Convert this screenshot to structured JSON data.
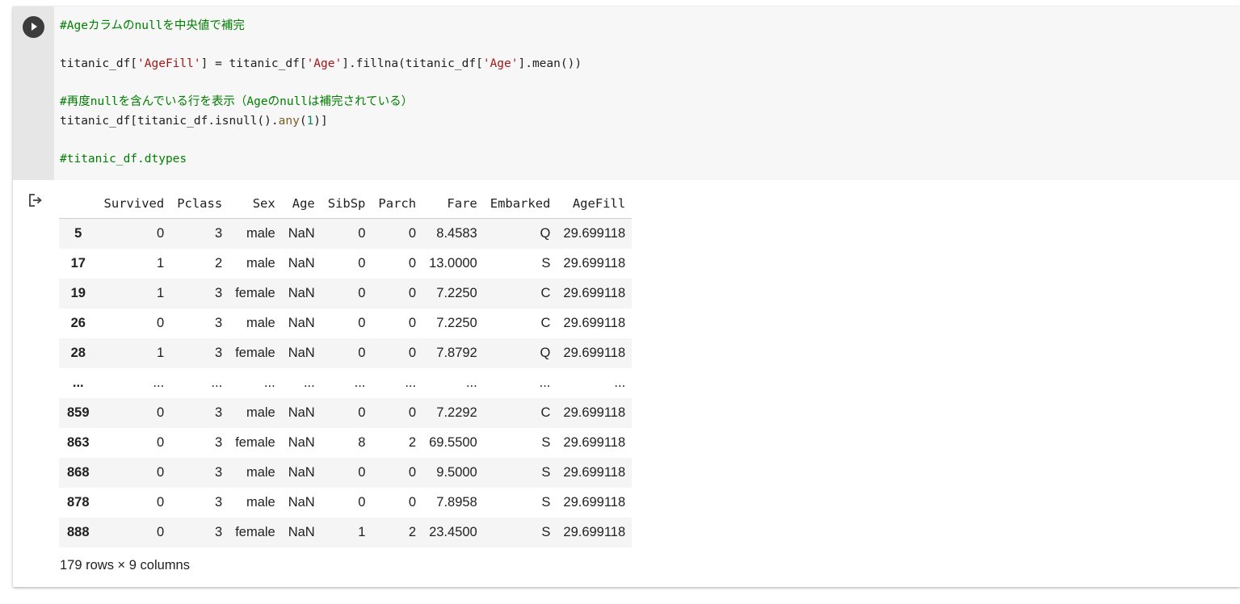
{
  "code": {
    "line1": "#Ageカラムのnullを中央値で補完",
    "line2": {
      "a": "titanic_df[",
      "b": "'AgeFill'",
      "c": "] = titanic_df[",
      "d": "'Age'",
      "e": "].fillna(titanic_df[",
      "f": "'Age'",
      "g": "].mean())"
    },
    "line3": "#再度nullを含んでいる行を表示（Ageのnullは補完されている）",
    "line4": {
      "a": "titanic_df[titanic_df.isnull().",
      "b": "any",
      "c": "(",
      "d": "1",
      "e": ")]"
    },
    "line5": "#titanic_df.dtypes"
  },
  "colors": {
    "comment": "#008000",
    "string": "#a31515",
    "number": "#098658",
    "function": "#795e26"
  },
  "icons": {
    "run": "play-circle-icon",
    "output": "output-arrow-icon"
  },
  "table": {
    "index_header": "",
    "columns": [
      "Survived",
      "Pclass",
      "Sex",
      "Age",
      "SibSp",
      "Parch",
      "Fare",
      "Embarked",
      "AgeFill"
    ],
    "rows": [
      {
        "index": "5",
        "cells": [
          "0",
          "3",
          "male",
          "NaN",
          "0",
          "0",
          "8.4583",
          "Q",
          "29.699118"
        ]
      },
      {
        "index": "17",
        "cells": [
          "1",
          "2",
          "male",
          "NaN",
          "0",
          "0",
          "13.0000",
          "S",
          "29.699118"
        ]
      },
      {
        "index": "19",
        "cells": [
          "1",
          "3",
          "female",
          "NaN",
          "0",
          "0",
          "7.2250",
          "C",
          "29.699118"
        ]
      },
      {
        "index": "26",
        "cells": [
          "0",
          "3",
          "male",
          "NaN",
          "0",
          "0",
          "7.2250",
          "C",
          "29.699118"
        ]
      },
      {
        "index": "28",
        "cells": [
          "1",
          "3",
          "female",
          "NaN",
          "0",
          "0",
          "7.8792",
          "Q",
          "29.699118"
        ]
      },
      {
        "index": "...",
        "cells": [
          "...",
          "...",
          "...",
          "...",
          "...",
          "...",
          "...",
          "...",
          "..."
        ]
      },
      {
        "index": "859",
        "cells": [
          "0",
          "3",
          "male",
          "NaN",
          "0",
          "0",
          "7.2292",
          "C",
          "29.699118"
        ]
      },
      {
        "index": "863",
        "cells": [
          "0",
          "3",
          "female",
          "NaN",
          "8",
          "2",
          "69.5500",
          "S",
          "29.699118"
        ]
      },
      {
        "index": "868",
        "cells": [
          "0",
          "3",
          "male",
          "NaN",
          "0",
          "0",
          "9.5000",
          "S",
          "29.699118"
        ]
      },
      {
        "index": "878",
        "cells": [
          "0",
          "3",
          "male",
          "NaN",
          "0",
          "0",
          "7.8958",
          "S",
          "29.699118"
        ]
      },
      {
        "index": "888",
        "cells": [
          "0",
          "3",
          "female",
          "NaN",
          "1",
          "2",
          "23.4500",
          "S",
          "29.699118"
        ]
      }
    ]
  },
  "summary": "179 rows × 9 columns"
}
